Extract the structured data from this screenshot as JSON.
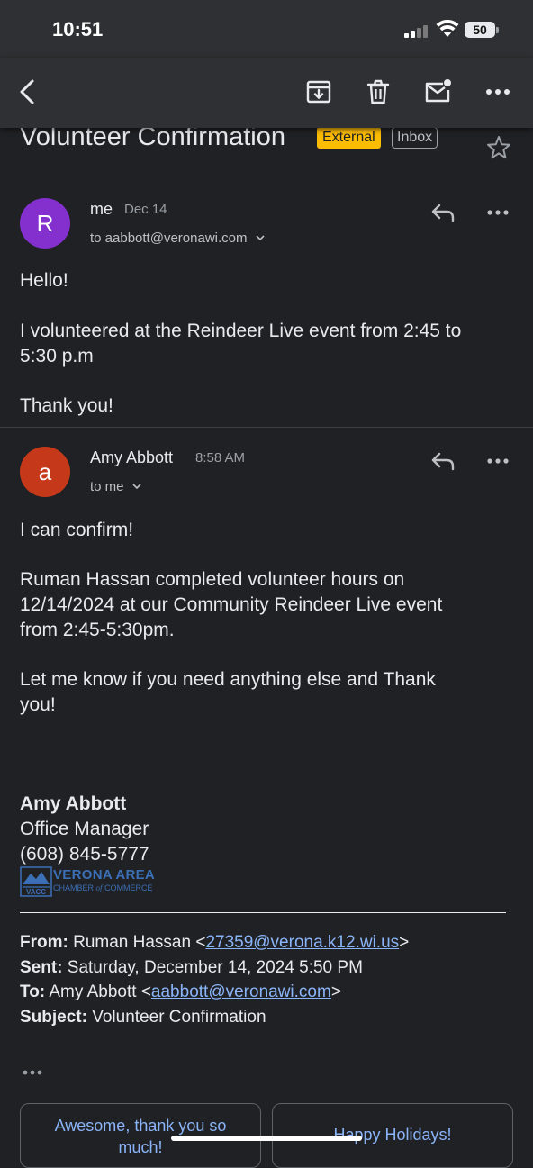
{
  "status_bar": {
    "time": "10:51",
    "battery": "50"
  },
  "toolbar": {
    "icons": [
      "back-icon",
      "archive-icon",
      "trash-icon",
      "mark-unread-icon",
      "more-icon"
    ]
  },
  "email": {
    "subject": "Volunteer Confirmation",
    "labels": {
      "external": "External",
      "inbox": "Inbox"
    }
  },
  "messages": [
    {
      "avatar_letter": "R",
      "avatar_color": "#8430ce",
      "sender": "me",
      "date": "Dec 14",
      "recipient": "to aabbott@veronawi.com",
      "body": [
        "Hello!",
        "I volunteered at the Reindeer Live event from 2:45 to",
        "5:30 p.m",
        "Thank you!"
      ]
    },
    {
      "avatar_letter": "a",
      "avatar_color": "#c5391a",
      "sender": "Amy Abbott",
      "date": "8:58 AM",
      "recipient": "to me",
      "body": [
        "I can confirm!",
        "Ruman Hassan completed volunteer hours on",
        "12/14/2024 at our Community Reindeer Live event",
        "from 2:45-5:30pm.",
        "Let me know if you need anything else and Thank",
        "you!"
      ],
      "signature": {
        "name": "Amy Abbott",
        "title": "Office Manager",
        "phone": "(608) 845-5777",
        "logo": {
          "line1": "VERONA AREA",
          "line2a": "CHAMBER",
          "line2b": "of",
          "line2c": "COMMERCE",
          "abbr": "VACC"
        }
      },
      "forwarded": {
        "from_label": "From:",
        "from_name": "Ruman Hassan <",
        "from_email": "27359@verona.k12.wi.us",
        "from_end": ">",
        "sent_label": "Sent:",
        "sent_value": "Saturday, December 14, 2024 5:50 PM",
        "to_label": "To:",
        "to_name": "Amy Abbott <",
        "to_email": "aabbott@veronawi.com",
        "to_end": ">",
        "subject_label": "Subject:",
        "subject_value": "Volunteer Confirmation"
      }
    }
  ],
  "smart_replies": [
    "Awesome, thank you so much!",
    "Happy Holidays!"
  ],
  "colors": {
    "background": "#202124",
    "bar": "#2f3033",
    "accent_link": "#8ab4f8",
    "external_badge": "#fbbc04"
  }
}
